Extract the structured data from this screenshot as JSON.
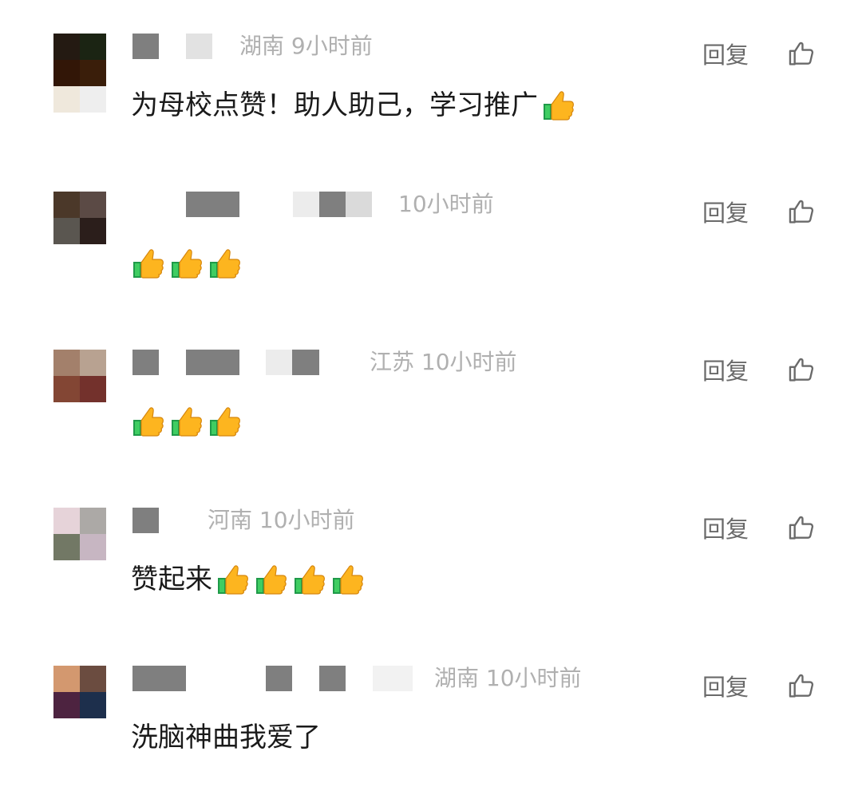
{
  "reply_label": "回复",
  "colors": {
    "meta_text": "#b0b0b0",
    "action_text": "#6a6a6a",
    "content_text": "#1a1a1a",
    "mosaic_dark": "#7f7f7f",
    "mosaic_light": "#e2e2e2"
  },
  "icons": {
    "like": "thumbs-up-outline-icon",
    "emoji": "thumbs-up-emoji-icon"
  },
  "comments": [
    {
      "location": "湖南",
      "time": "9小时前",
      "meta": "湖南 9小时前",
      "text": "为母校点赞！助人助己，学习推广",
      "emoji_count": 1,
      "avatar_colors": [
        "#241a12",
        "#1b2413",
        "#321607",
        "#3a1e0a",
        "#efe8dc",
        "#eeeeee"
      ]
    },
    {
      "location": "",
      "time": "10小时前",
      "meta": "10小时前",
      "text": "",
      "emoji_count": 3,
      "avatar_colors": [
        "#4b3829",
        "#5b4a45",
        "#5a5650",
        "#2b1e1b"
      ]
    },
    {
      "location": "江苏",
      "time": "10小时前",
      "meta": "江苏 10小时前",
      "text": "",
      "emoji_count": 3,
      "avatar_colors": [
        "#a3806b",
        "#b8a291",
        "#834634",
        "#73312c"
      ]
    },
    {
      "location": "河南",
      "time": "10小时前",
      "meta": "河南 10小时前",
      "text": "赞起来",
      "emoji_count": 4,
      "avatar_colors": [
        "#e6d3d9",
        "#aca9a6",
        "#727865",
        "#c7b6c2"
      ]
    },
    {
      "location": "湖南",
      "time": "10小时前",
      "meta": "湖南 10小时前",
      "text": "洗脑神曲我爱了",
      "emoji_count": 0,
      "avatar_colors": [
        "#d3986f",
        "#6b4c40",
        "#4d2340",
        "#1d2f4c"
      ]
    }
  ]
}
